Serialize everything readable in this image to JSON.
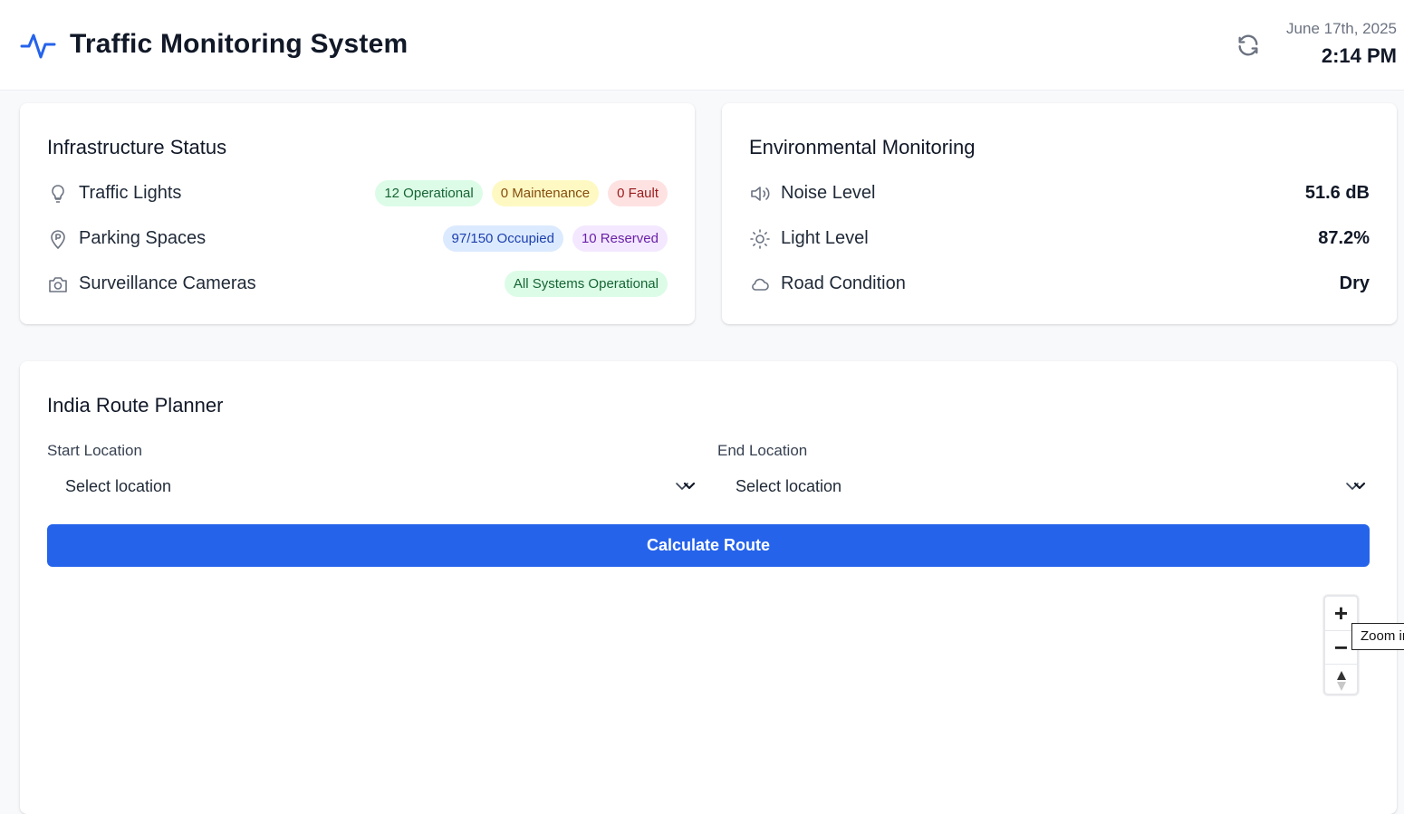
{
  "header": {
    "title": "Traffic Monitoring System",
    "date": "June 17th, 2025",
    "time": "2:14 PM",
    "logo_icon": "activity-icon",
    "refresh_icon": "refresh-icon",
    "accent_color": "#2563eb"
  },
  "infrastructure": {
    "title": "Infrastructure Status",
    "rows": [
      {
        "label": "Traffic Lights",
        "icon": "lightbulb-icon",
        "badges": [
          "12 Operational",
          "0 Maintenance",
          "0 Fault"
        ]
      },
      {
        "label": "Parking Spaces",
        "icon": "map-pin-icon",
        "badges": [
          "97/150 Occupied",
          "10 Reserved"
        ]
      },
      {
        "label": "Surveillance Cameras",
        "icon": "camera-icon",
        "badges": [
          "All Systems Operational"
        ]
      }
    ]
  },
  "environment": {
    "title": "Environmental Monitoring",
    "rows": [
      {
        "label": "Noise Level",
        "icon": "speaker-icon",
        "value": "51.6 dB"
      },
      {
        "label": "Light Level",
        "icon": "sun-icon",
        "value": "87.2%"
      },
      {
        "label": "Road Condition",
        "icon": "cloud-icon",
        "value": "Dry"
      }
    ]
  },
  "route": {
    "title": "India Route Planner",
    "start_label": "Start Location",
    "start_value": "Select location",
    "end_label": "End Location",
    "end_value": "Select location",
    "calculate_label": "Calculate Route"
  },
  "map": {
    "zoom_in_symbol": "+",
    "zoom_out_symbol": "−",
    "tooltip": "Zoom in"
  }
}
